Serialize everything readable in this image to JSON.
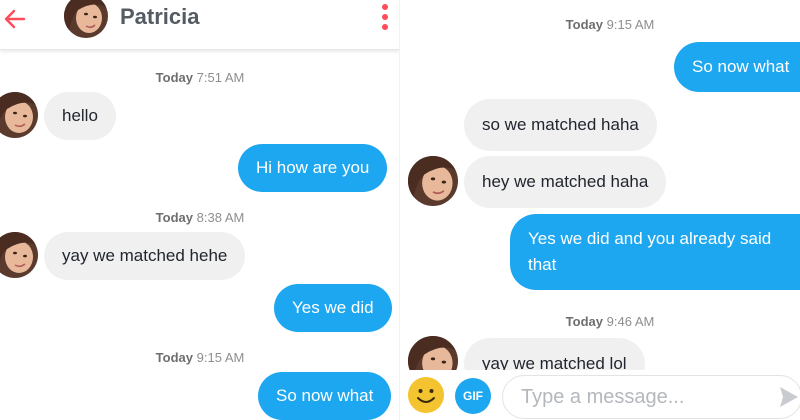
{
  "left_screen": {
    "header": {
      "contact_name": "Patricia",
      "back_icon": "arrow-left-icon",
      "menu_icon": "more-vertical-icon"
    },
    "timestamps": [
      {
        "day": "Today",
        "time": "7:51 AM"
      },
      {
        "day": "Today",
        "time": "8:38 AM"
      },
      {
        "day": "Today",
        "time": "9:15 AM"
      }
    ],
    "messages": [
      {
        "from": "contact",
        "text": "hello"
      },
      {
        "from": "me",
        "text": "Hi how are you"
      },
      {
        "from": "contact",
        "text": "yay we matched hehe"
      },
      {
        "from": "me",
        "text": "Yes we did"
      },
      {
        "from": "me",
        "text": "So now what"
      }
    ]
  },
  "right_screen": {
    "timestamps": [
      {
        "day": "Today",
        "time": "9:15 AM"
      },
      {
        "day": "Today",
        "time": "9:46 AM"
      }
    ],
    "messages": [
      {
        "from": "me",
        "text": "So now what"
      },
      {
        "from": "contact",
        "text": "so we matched haha"
      },
      {
        "from": "contact",
        "text": "hey we matched haha"
      },
      {
        "from": "me",
        "text": "Yes we did and you already said that"
      },
      {
        "from": "contact",
        "text": "yay we matched lol"
      }
    ],
    "composer": {
      "emoji_icon": "smiley-icon",
      "gif_label": "GIF",
      "placeholder": "Type a message...",
      "send_icon": "send-icon"
    }
  },
  "colors": {
    "sent_bubble": "#1ea7f1",
    "received_bubble": "#f0f0f1",
    "accent_red": "#fd4d5a",
    "emoji_yellow": "#f4c430"
  }
}
